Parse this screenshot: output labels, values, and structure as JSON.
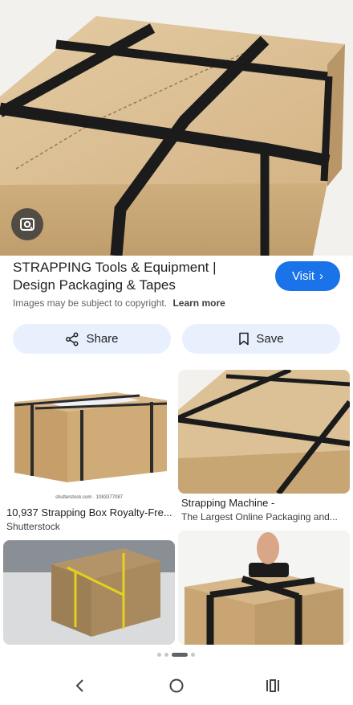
{
  "colors": {
    "accent": "#1a73e8",
    "pill_bg": "#e8f0fe",
    "cardboard": "#c9a777",
    "strap": "#1b1b1b",
    "yellow_strap": "#e5d11c"
  },
  "hero": {
    "lens_icon": "lens-icon"
  },
  "result": {
    "title": "STRAPPING Tools & Equipment | Design Packaging & Tapes",
    "visit_label": "Visit",
    "copyright_note": "Images may be subject to copyright.",
    "learn_more": "Learn more",
    "share_label": "Share",
    "save_label": "Save"
  },
  "related": [
    {
      "title": "10,937 Strapping Box Royalty-Fre...",
      "source": "Shutterstock",
      "watermark": "shutterstock.com · 1083377087"
    },
    {
      "title": "Strapping Machine -",
      "source": "The Largest Online Packaging and..."
    },
    {
      "title": "",
      "source": ""
    },
    {
      "title": "",
      "source": ""
    }
  ],
  "pager": {
    "count": 4,
    "active": 2
  }
}
